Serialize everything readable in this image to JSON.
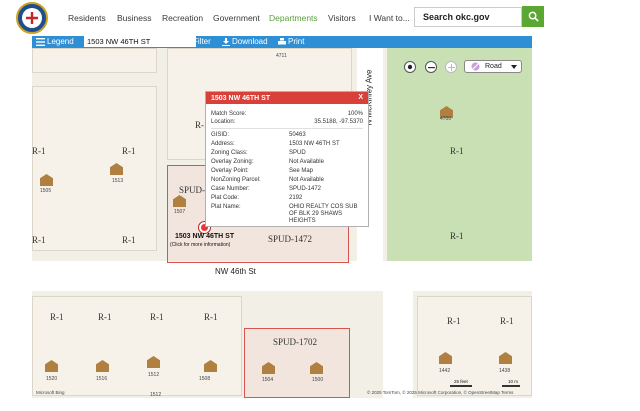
{
  "site": {
    "nav": [
      "Residents",
      "Business",
      "Recreation",
      "Government",
      "Departments",
      "Visitors",
      "I Want to..."
    ],
    "search_label": "Search okc.gov",
    "accent": "#5aa832"
  },
  "toolbar": {
    "legend": "Legend",
    "address_value": "1503 NW 46TH ST",
    "filter": "Filter",
    "download": "Download",
    "print": "Print",
    "color": "#2f8fd5"
  },
  "map": {
    "basemap": "Road",
    "street_ns": "N McKinley Ave",
    "street_ew": "NW 46th St",
    "zones": [
      "R-1",
      "R-1",
      "R-1",
      "R-1",
      "R-1",
      "R-1",
      "R-1",
      "R-1",
      "R-1",
      "R-1",
      "R-1",
      "R-1",
      "R-1",
      "SPUD-",
      "SPUD-1472",
      "SPUD-1702"
    ],
    "addresses": [
      "4711",
      "4700",
      "1513",
      "1507",
      "1505",
      "1520",
      "1516",
      "1512",
      "1508",
      "1504",
      "1500",
      "1442",
      "1438",
      "1512"
    ],
    "pin_label": "1503 NW 46TH ST",
    "pin_sub": "(Click for more information)",
    "attribution": "© 2025 TomTom, © 2025 Microsoft Corporation, © OpenStreetMap   Terms",
    "scale_ft": "25 feet",
    "scale_m": "10 m",
    "brand": "Microsoft Bing",
    "grid_color": "#d9534f"
  },
  "popup": {
    "title": "1503 NW 46TH ST",
    "close": "X",
    "match_label": "Match Score:",
    "match_value": "100%",
    "location_label": "Location:",
    "location_value": "35.5188, -97.5370",
    "rows": [
      {
        "label": "GISID:",
        "value": "50463"
      },
      {
        "label": "Address:",
        "value": "1503 NW 46TH ST"
      },
      {
        "label": "Zoning Class:",
        "value": "SPUD"
      },
      {
        "label": "Overlay Zoning:",
        "value": "Not Available"
      },
      {
        "label": "Overlay Point:",
        "value": "See Map"
      },
      {
        "label": "NonZoning Parcel:",
        "value": "Not Available"
      },
      {
        "label": "Case Number:",
        "value": "SPUD-1472"
      },
      {
        "label": "Plat Code:",
        "value": "2192"
      },
      {
        "label": "Plat Name:",
        "value": "OHIO REALTY COS SUB OF BLK 29 SHAWS HEIGHTS"
      }
    ]
  }
}
